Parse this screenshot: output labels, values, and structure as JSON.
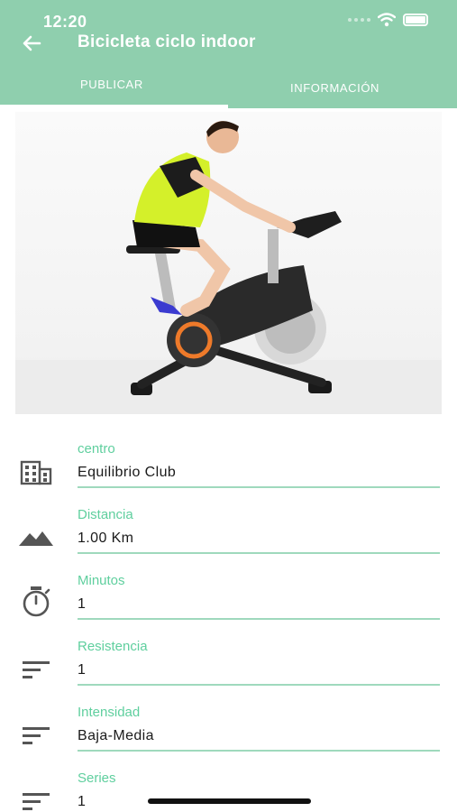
{
  "status_bar": {
    "time": "12:20"
  },
  "header": {
    "title": "Bicicleta ciclo indoor",
    "tabs": [
      {
        "label": "PUBLICAR",
        "active": true
      },
      {
        "label": "INFORMACIÓN",
        "active": false
      }
    ]
  },
  "theme": {
    "accent": "#8fcfae",
    "label_color": "#5fcf9e",
    "line_color": "#9fd9bd"
  },
  "form": {
    "fields": [
      {
        "label": "centro",
        "value": "Equilibrio Club",
        "icon": "building-icon"
      },
      {
        "label": "Distancia",
        "value": "1.00 Km",
        "icon": "mountain-icon"
      },
      {
        "label": "Minutos",
        "value": "1",
        "icon": "stopwatch-icon"
      },
      {
        "label": "Resistencia",
        "value": "1",
        "icon": "sort-lines-icon"
      },
      {
        "label": "Intensidad",
        "value": "Baja-Media",
        "icon": "sort-lines-icon"
      },
      {
        "label": "Series",
        "value": "1",
        "icon": "sort-lines-icon"
      }
    ]
  }
}
